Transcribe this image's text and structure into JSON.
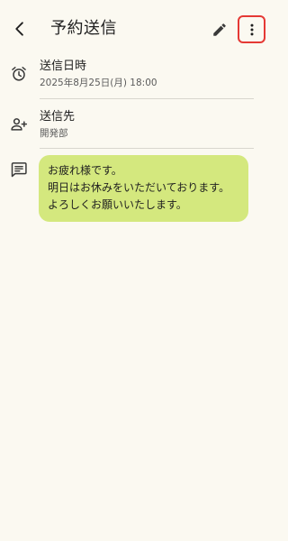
{
  "appbar": {
    "title": "予約送信",
    "back_icon": "arrow-back-icon",
    "edit_icon": "pencil-icon",
    "more_icon": "more-vert-icon",
    "highlight_color": "#e53935"
  },
  "schedule": {
    "label": "送信日時",
    "value": "2025年8月25日(月) 18:00",
    "icon": "alarm-icon"
  },
  "recipient": {
    "label": "送信先",
    "value": "開発部",
    "icon": "person-add-icon"
  },
  "message": {
    "icon": "message-icon",
    "lines": [
      "お疲れ様です。",
      "明日はお休みをいただいております。",
      "よろしくお願いいたします。"
    ],
    "bubble_color": "#d4e87e"
  }
}
